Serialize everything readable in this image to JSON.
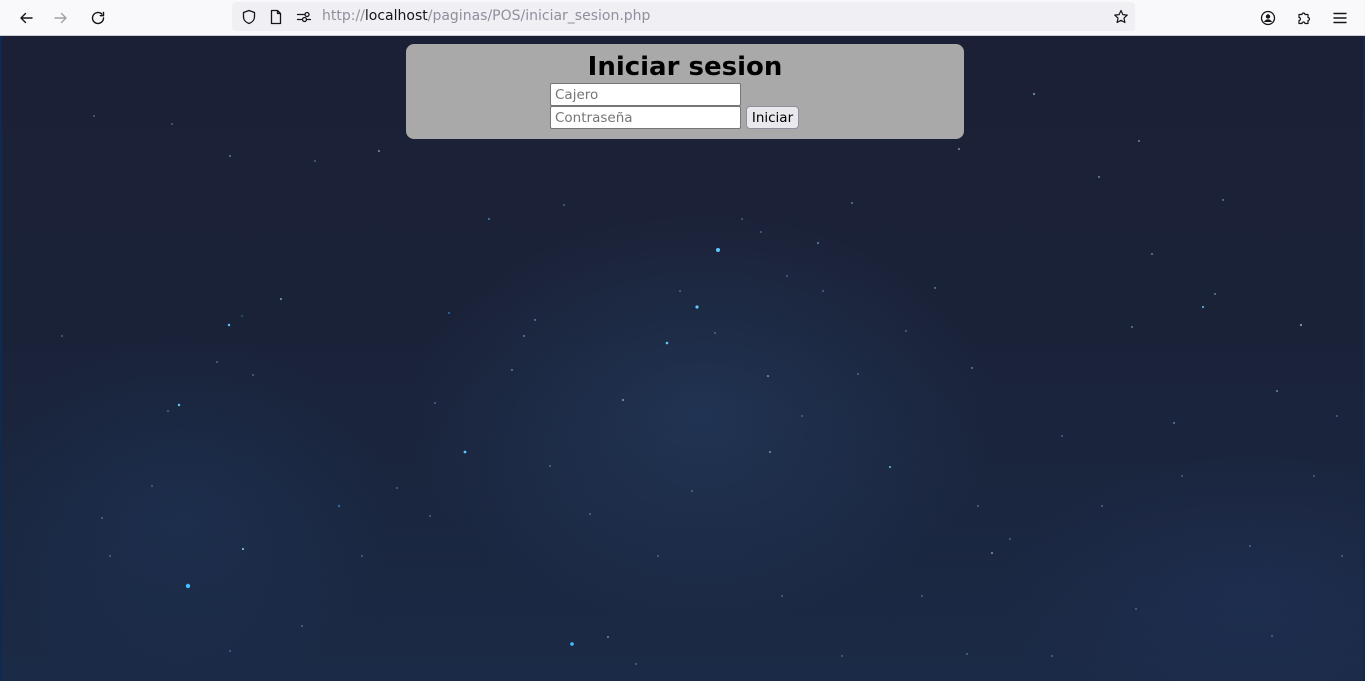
{
  "browser": {
    "url_prefix": "http://",
    "url_host": "localhost",
    "url_path": "/paginas/POS/iniciar_sesion.php"
  },
  "login": {
    "title": "Iniciar sesion",
    "user_placeholder": "Cajero",
    "password_placeholder": "Contraseña",
    "submit_label": "Iniciar"
  },
  "colors": {
    "panel": "#a9a9a9",
    "background": "#1b2238"
  },
  "icons": {
    "back": "arrow-left-icon",
    "forward": "arrow-right-icon",
    "reload": "reload-icon",
    "shield": "shield-icon",
    "page": "page-icon",
    "permissions": "permissions-icon",
    "bookmark": "star-icon",
    "account": "account-icon",
    "extensions": "puzzle-icon",
    "menu": "hamburger-menu-icon"
  }
}
